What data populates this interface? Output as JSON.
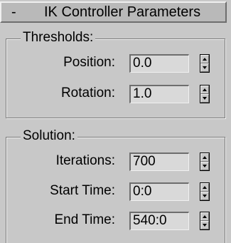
{
  "rollout": {
    "collapse_glyph": "-",
    "title": "IK Controller Parameters"
  },
  "thresholds": {
    "title": "Thresholds:",
    "position": {
      "label": "Position:",
      "value": "0.0"
    },
    "rotation": {
      "label": "Rotation:",
      "value": "1.0"
    }
  },
  "solution": {
    "title": "Solution:",
    "iterations": {
      "label": "Iterations:",
      "value": "700"
    },
    "start_time": {
      "label": "Start Time:",
      "value": "0:0"
    },
    "end_time": {
      "label": "End Time:",
      "value": "540:0"
    }
  },
  "icons": {
    "spinner": "spinner-up-down-icon"
  }
}
